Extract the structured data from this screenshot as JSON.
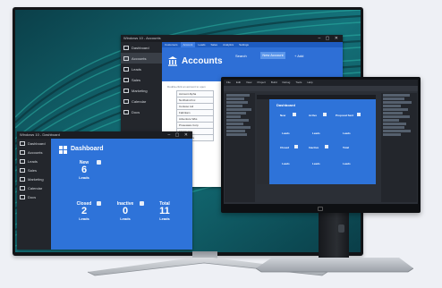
{
  "accounts_window": {
    "title": "Windows 10 - Accounts",
    "tabs": [
      "Customers",
      "Account",
      "Leads",
      "Sales",
      "Analytics",
      "Settings"
    ],
    "active_tab_index": 1,
    "sidebar": [
      "Dashboard",
      "Accounts",
      "Leads",
      "Sales",
      "Marketing",
      "Calendar",
      "Docs"
    ],
    "heading": "Accounts",
    "search_label": "Search",
    "action_button": "New Account",
    "new_label": "+ Add",
    "hint": "Double-click an account to open",
    "list": [
      "Account Alpha",
      "Northwind Inc",
      "Contoso Ltd",
      "Fabrikam",
      "Adventure Wks",
      "Proseware Corp",
      "Litware Inc",
      "Tailspin Toys"
    ]
  },
  "dashboard_window": {
    "title": "Windows 10 - Dashboard",
    "sidebar": [
      "Dashboard",
      "Accounts",
      "Leads",
      "Sales",
      "Marketing",
      "Calendar",
      "Docs"
    ],
    "heading": "Dashboard",
    "tiles": [
      {
        "label": "New",
        "value": "6",
        "sub": "Leads"
      },
      {
        "label": "Closed",
        "value": "2",
        "sub": "Leads"
      },
      {
        "label": "Inactive",
        "value": "0",
        "sub": "Leads"
      },
      {
        "label": "Total",
        "value": "11",
        "sub": "Leads"
      }
    ]
  },
  "ide": {
    "menu": [
      "File",
      "Edit",
      "View",
      "Project",
      "Build",
      "Debug",
      "Tools",
      "Help"
    ],
    "designer_heading": "Dashboard",
    "tiles": [
      "New",
      "Active",
      "Proposal Sent",
      "Leads",
      "Leads",
      "Leads",
      "Closed",
      "Inactive",
      "Total",
      "Leads",
      "Leads",
      "Leads"
    ]
  },
  "colors": {
    "accent_blue": "#2e73d9",
    "dark_chrome": "#1b1d22",
    "wallpaper_teal": "#0d4f57"
  }
}
